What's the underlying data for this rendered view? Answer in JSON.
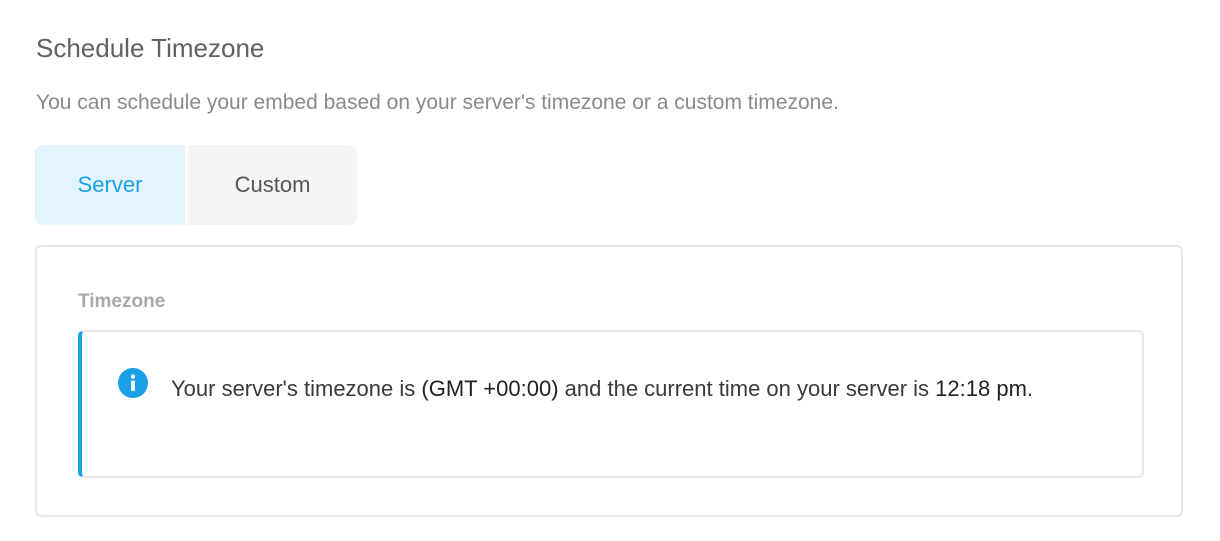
{
  "section": {
    "title": "Schedule Timezone",
    "description": "You can schedule your embed based on your server's timezone or a custom timezone."
  },
  "tabs": [
    {
      "label": "Server",
      "active": true
    },
    {
      "label": "Custom",
      "active": false
    }
  ],
  "panel": {
    "field_label": "Timezone",
    "notice": {
      "icon": "info-icon",
      "text_before": "Your server's timezone is ",
      "timezone": "(GMT +00:00)",
      "text_middle": " and the current time on your server is ",
      "current_time": "12:18 pm",
      "text_after": "."
    }
  },
  "colors": {
    "accent": "#1aa0e6",
    "active_tab_bg": "#e3f4fc",
    "inactive_tab_bg": "#f5f5f5",
    "border": "#e6e6e6"
  }
}
